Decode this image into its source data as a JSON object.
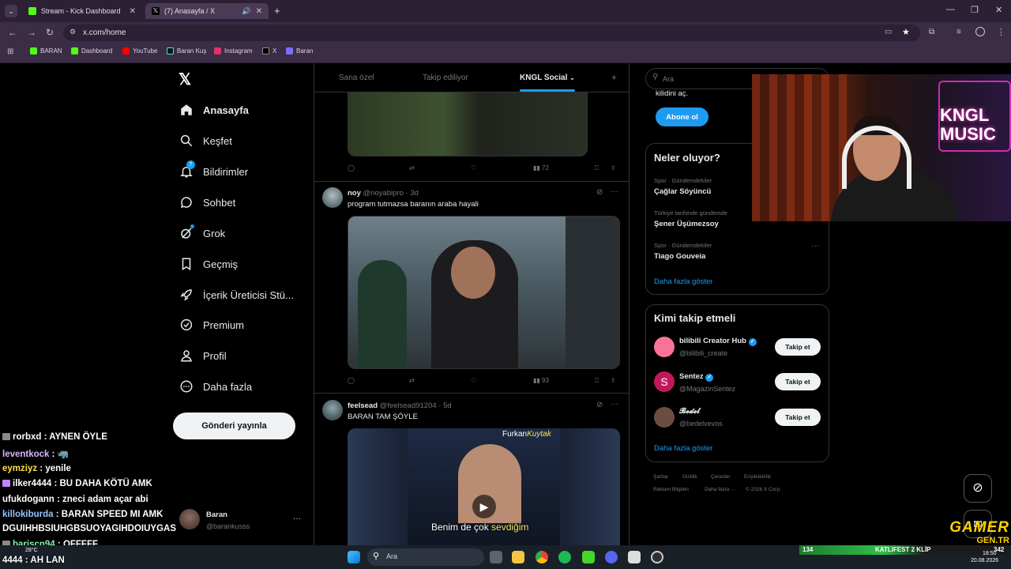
{
  "browser": {
    "tabs": [
      {
        "title": "Stream - Kick Dashboard",
        "active": false
      },
      {
        "title": "(7) Anasayfa / X",
        "active": true
      }
    ],
    "url": "x.com/home",
    "bookmarks": [
      "BARAN",
      "Dashboard",
      "YouTube",
      "Baran Kuş",
      "Instagram",
      "X",
      "Baran"
    ]
  },
  "sidebar": {
    "items": [
      {
        "label": "Anasayfa",
        "icon": "home-icon",
        "bold": true
      },
      {
        "label": "Keşfet",
        "icon": "search-icon"
      },
      {
        "label": "Bildirimler",
        "icon": "bell-icon",
        "badge": "7"
      },
      {
        "label": "Sohbet",
        "icon": "chat-icon"
      },
      {
        "label": "Grok",
        "icon": "grok-icon"
      },
      {
        "label": "Geçmiş",
        "icon": "bookmark-icon"
      },
      {
        "label": "İçerik Üreticisi Stü...",
        "icon": "rocket-icon"
      },
      {
        "label": "Premium",
        "icon": "verified-icon"
      },
      {
        "label": "Profil",
        "icon": "person-icon"
      },
      {
        "label": "Daha fazla",
        "icon": "more-circle-icon"
      }
    ],
    "post_button": "Gönderi yayınla",
    "account": {
      "name": "Baran",
      "handle": "@barankusss"
    }
  },
  "timeline": {
    "tabs": [
      "Sana özel",
      "Takip ediliyor",
      "KNGL Social"
    ],
    "active_tab": "KNGL Social",
    "first_post_views": "72",
    "posts": [
      {
        "name": "noy",
        "handle": "@noyabipro",
        "time": "3d",
        "text": "program tutmazsa baranın araba hayali",
        "views": "93"
      },
      {
        "name": "feelsead",
        "handle": "@feelsead91204",
        "time": "5d",
        "text": "BARAN TAM ŞÖYLE",
        "video_credit_a": "Furkan",
        "video_credit_b": "Kuytak",
        "caption_a": "Benim de çok ",
        "caption_b": "sevdiğim"
      }
    ]
  },
  "right": {
    "search_placeholder": "Ara",
    "premium_tail": "kilidini aç.",
    "subscribe_button": "Abone ol",
    "trends_title": "Neler oluyor?",
    "trends": [
      {
        "category": "Spor · Gündemdekiler",
        "name": "Çağlar Söyüncü"
      },
      {
        "category": "Türkiye tarihinde gündemde",
        "name": "Şener Üşümezsoy"
      },
      {
        "category": "Spor · Gündemdekiler",
        "name": "Tiago Gouveia"
      }
    ],
    "show_more": "Daha fazla göster",
    "who_to_follow_title": "Kimi takip etmeli",
    "suggestions": [
      {
        "name": "bilibili Creator Hub",
        "handle": "@bilibili_create",
        "verified": true,
        "color": "#fb7299"
      },
      {
        "name": "Sentez",
        "handle": "@MagazinSentez",
        "verified": true,
        "color": "#c2185b"
      },
      {
        "name": "𝓑𝓮𝓭𝓮𝓵",
        "handle": "@bedelvevos",
        "verified": false,
        "color": "#6d4c41"
      }
    ],
    "follow_label": "Takip et",
    "show_more_2": "Daha fazla göster",
    "footer": [
      "Şartlar",
      "Gizlilik",
      "Çerezler",
      "Erişilebilirlik",
      "Reklam Bilgileri",
      "Daha fazla ···",
      "© 2026 X Corp."
    ]
  },
  "stream_overlay": {
    "chat": [
      {
        "user": "rorbxd",
        "msg": "AYNEN ÖYLE",
        "color": "#ffffff"
      },
      {
        "user": "leventkock",
        "msg": "",
        "color": "#d8b4fe"
      },
      {
        "user": "eymziyz",
        "msg": "yenile",
        "color": "#fde047"
      },
      {
        "user": "ilker4444",
        "msg": "BU DAHA KÖTÜ AMK",
        "color": "#ffffff"
      },
      {
        "user": "ufukdogann",
        "msg": "zneci adam açar abi",
        "color": "#ffffff"
      },
      {
        "user": "killokiburda",
        "msg": "BARAN SPEED MI AMK",
        "color": "#93c5fd"
      },
      {
        "user": "",
        "msg": "DGUIHHBSIUHGBSUOYAGIHDOIUYGAS",
        "color": "#ffffff"
      },
      {
        "user": "bariscn94",
        "msg": "OFFFFF",
        "color": "#86efac"
      },
      {
        "user": "4444",
        "msg": "AH LAN",
        "color": "#ffffff"
      }
    ],
    "cam_sign": "KNGL MUSIC",
    "logo_a": "GAMER",
    "logo_b": "GEN.TR",
    "event_num": "134",
    "event_text": "KATLIFEST 2 KLİP",
    "event_num2": "342"
  },
  "taskbar": {
    "search": "Ara",
    "weather": "28°C",
    "time": "18:50",
    "date": "20.08.2026"
  },
  "colors": {
    "accent": "#1d9bf0",
    "bg": "#000000",
    "border": "#2f3336",
    "muted": "#71767b"
  }
}
